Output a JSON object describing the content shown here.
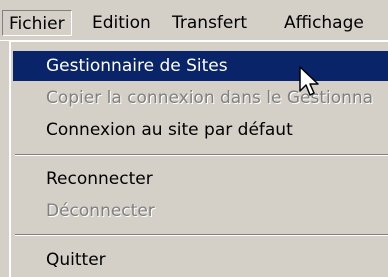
{
  "menubar": {
    "items": [
      {
        "label": "Fichier"
      },
      {
        "label": "Edition"
      },
      {
        "label": "Transfert"
      },
      {
        "label": "Affichage"
      }
    ]
  },
  "file_menu": {
    "site_manager": "Gestionnaire de Sites",
    "copy_connection": "Copier la connexion dans le Gestionna",
    "default_connect": "Connexion au site par défaut",
    "reconnect": "Reconnecter",
    "disconnect": "Déconnecter",
    "quit": "Quitter"
  },
  "colors": {
    "highlight": "#0a246a",
    "menu_bg": "#d4d0c8",
    "disabled_text": "#808080"
  },
  "icons": {
    "cursor": "mouse-pointer-icon"
  }
}
